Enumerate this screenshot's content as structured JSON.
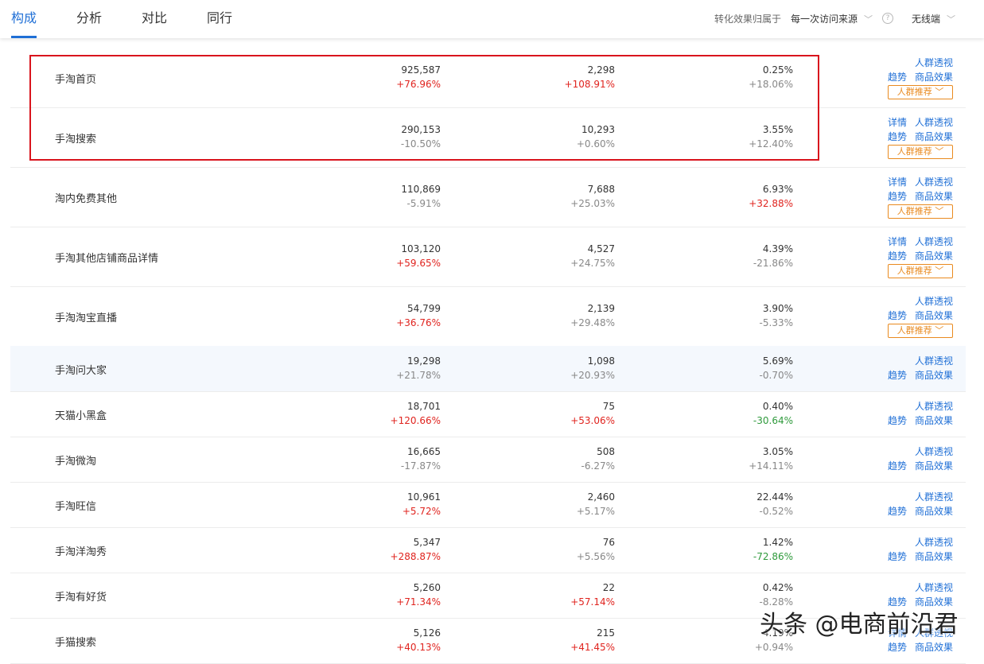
{
  "tabs": [
    "构成",
    "分析",
    "对比",
    "同行"
  ],
  "controls": {
    "attribution_label": "转化效果归属于",
    "attribution_value": "每一次访问来源",
    "help": "?",
    "device_value": "无线端"
  },
  "actions": {
    "detail": "详情",
    "crowd": "人群透视",
    "trend": "趋势",
    "product": "商品效果",
    "recommend": "人群推荐"
  },
  "rows": [
    {
      "name": "手淘首页",
      "v1": "925,587",
      "c1": "+76.96%",
      "v2": "2,298",
      "c2": "+108.91%",
      "v3": "0.25%",
      "c3": "+18.06%"
    },
    {
      "name": "手淘搜索",
      "v1": "290,153",
      "c1": "-10.50%",
      "v2": "10,293",
      "c2": "+0.60%",
      "v3": "3.55%",
      "c3": "+12.40%"
    },
    {
      "name": "淘内免费其他",
      "v1": "110,869",
      "c1": "-5.91%",
      "v2": "7,688",
      "c2": "+25.03%",
      "v3": "6.93%",
      "c3": "+32.88%"
    },
    {
      "name": "手淘其他店铺商品详情",
      "v1": "103,120",
      "c1": "+59.65%",
      "v2": "4,527",
      "c2": "+24.75%",
      "v3": "4.39%",
      "c3": "-21.86%"
    },
    {
      "name": "手淘淘宝直播",
      "v1": "54,799",
      "c1": "+36.76%",
      "v2": "2,139",
      "c2": "+29.48%",
      "v3": "3.90%",
      "c3": "-5.33%"
    },
    {
      "name": "手淘问大家",
      "v1": "19,298",
      "c1": "+21.78%",
      "v2": "1,098",
      "c2": "+20.93%",
      "v3": "5.69%",
      "c3": "-0.70%"
    },
    {
      "name": "天猫小黑盒",
      "v1": "18,701",
      "c1": "+120.66%",
      "v2": "75",
      "c2": "+53.06%",
      "v3": "0.40%",
      "c3": "-30.64%"
    },
    {
      "name": "手淘微淘",
      "v1": "16,665",
      "c1": "-17.87%",
      "v2": "508",
      "c2": "-6.27%",
      "v3": "3.05%",
      "c3": "+14.11%"
    },
    {
      "name": "手淘旺信",
      "v1": "10,961",
      "c1": "+5.72%",
      "v2": "2,460",
      "c2": "+5.17%",
      "v3": "22.44%",
      "c3": "-0.52%"
    },
    {
      "name": "手淘洋淘秀",
      "v1": "5,347",
      "c1": "+288.87%",
      "v2": "76",
      "c2": "+5.56%",
      "v3": "1.42%",
      "c3": "-72.86%"
    },
    {
      "name": "手淘有好货",
      "v1": "5,260",
      "c1": "+71.34%",
      "v2": "22",
      "c2": "+57.14%",
      "v3": "0.42%",
      "c3": "-8.28%"
    },
    {
      "name": "手猫搜索",
      "v1": "5,126",
      "c1": "+40.13%",
      "v2": "215",
      "c2": "+41.45%",
      "v3": "4.19%",
      "c3": "+0.94%"
    }
  ],
  "watermark": "头条 @电商前沿君"
}
